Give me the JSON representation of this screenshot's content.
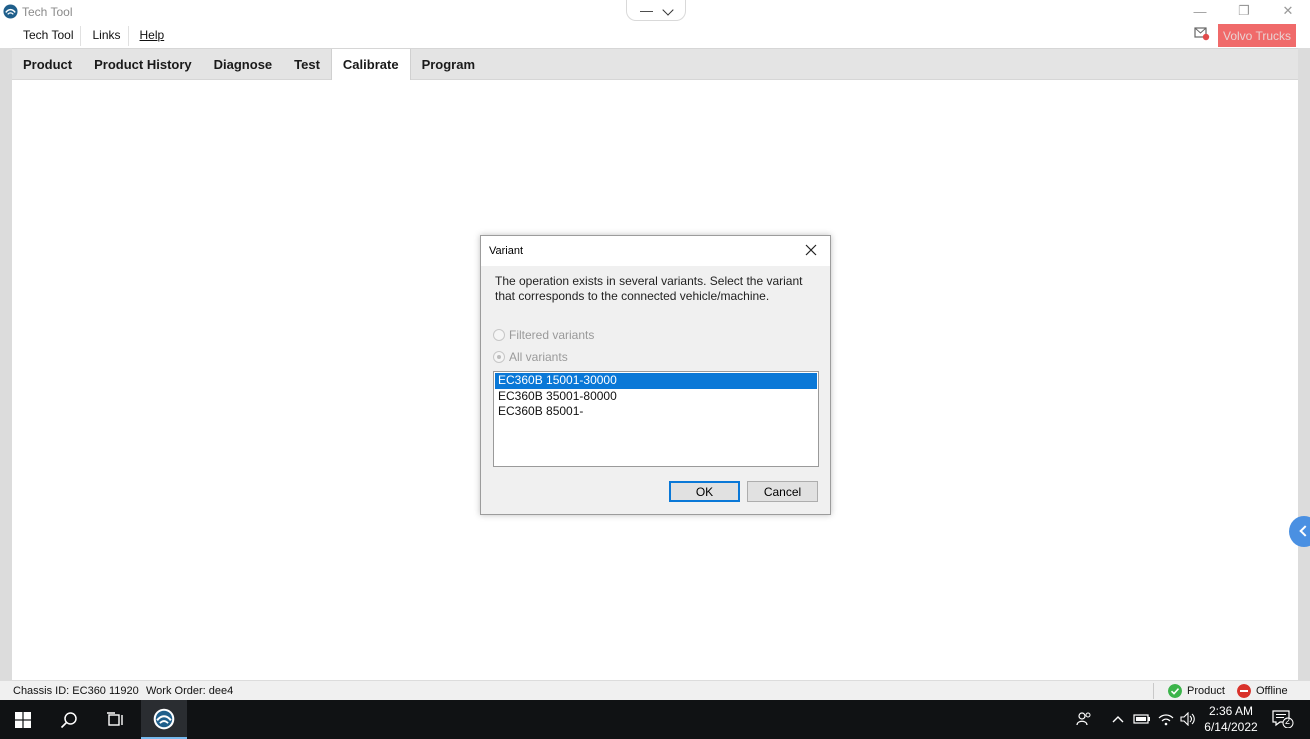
{
  "window": {
    "title": "Tech Tool",
    "center_tab": {
      "minimize_glyph": "—"
    },
    "controls": {
      "minimize": "—",
      "restore": "❐",
      "close": "✕"
    }
  },
  "menu": {
    "items": [
      {
        "label": "Tech Tool"
      },
      {
        "label": "Links"
      },
      {
        "label": "Help"
      }
    ],
    "brand_button": "Volvo Trucks"
  },
  "tabs": [
    {
      "label": "Product"
    },
    {
      "label": "Product History"
    },
    {
      "label": "Diagnose"
    },
    {
      "label": "Test"
    },
    {
      "label": "Calibrate",
      "active": true
    },
    {
      "label": "Program"
    }
  ],
  "dialog": {
    "title": "Variant",
    "message": "The operation exists in several variants. Select the variant that corresponds to the connected vehicle/machine.",
    "radio_filtered": "Filtered variants",
    "radio_all": "All variants",
    "variants": [
      {
        "label": "EC360B 15001-30000",
        "selected": true
      },
      {
        "label": "EC360B 35001-80000"
      },
      {
        "label": "EC360B 85001-"
      }
    ],
    "ok_label": "OK",
    "cancel_label": "Cancel"
  },
  "status": {
    "chassis": "Chassis ID: EC360 11920",
    "work_order": "Work Order: dee4",
    "product": "Product",
    "offline": "Offline",
    "product_color": "#3cb44b",
    "offline_color": "#d9322b"
  },
  "taskbar": {
    "time": "2:36 AM",
    "date": "6/14/2022",
    "notifications": "2"
  },
  "colors": {
    "accent": "#0a78d7",
    "brand": "#f06a6a",
    "taskbar": "#101214"
  }
}
